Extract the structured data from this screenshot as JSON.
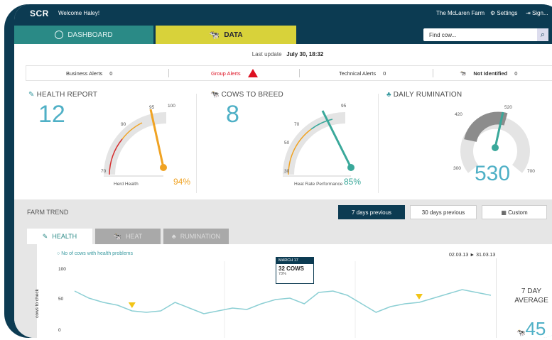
{
  "topbar": {
    "logo": "SCR",
    "welcome": "Welcome Haley!",
    "farm": "The McLaren Farm",
    "settings": "Settings",
    "signout": "Sign..."
  },
  "tabs": [
    {
      "label": "DASHBOARD",
      "icon": "gauge-icon"
    },
    {
      "label": "DATA",
      "icon": "cow-icon"
    }
  ],
  "search": {
    "placeholder": "Find cow..."
  },
  "last_update": {
    "label": "Last update",
    "value": "July 30, 18:32"
  },
  "alerts": [
    {
      "label": "Business Alerts",
      "count": "0"
    },
    {
      "label": "Group Alerts",
      "count": ""
    },
    {
      "label": "Technical Alerts",
      "count": "0"
    },
    {
      "label": "Not Identified",
      "count": "0"
    }
  ],
  "health": {
    "title": "HEALTH REPORT",
    "value": "12",
    "ticks": [
      "70",
      "90",
      "95",
      "100"
    ],
    "gauge_label": "Herd Health",
    "percent": "94%",
    "color": "#f0a323"
  },
  "breed": {
    "title": "COWS TO BREED",
    "value": "8",
    "ticks": [
      "30",
      "50",
      "70",
      "95"
    ],
    "gauge_label": "Heat Rate Performance",
    "percent": "85%",
    "color": "#3aa89a"
  },
  "rumination": {
    "title": "DAILY RUMINATION",
    "value": "530",
    "ticks": [
      "420",
      "520",
      "300",
      "700"
    ]
  },
  "farm_trend": {
    "title": "FARM TREND",
    "buttons": [
      "7 days previous",
      "30 days previous",
      "Custom"
    ],
    "subtabs": [
      "HEALTH",
      "HEAT",
      "RUMINATION"
    ],
    "legend": "No of cows with health problems",
    "date_range": "02.03.13 ► 31.03.13",
    "ylabel": "cows to check",
    "yticks": [
      "100",
      "50",
      "0"
    ],
    "tooltip": {
      "head": "MARCH 17",
      "main": "32 COWS",
      "sub": "73%"
    },
    "avg_label_1": "7 DAY",
    "avg_label_2": "AVERAGE",
    "avg_value": "45"
  },
  "chart_data": {
    "type": "line",
    "series": [
      {
        "values": [
          68,
          58,
          52,
          48,
          40,
          38,
          40,
          52,
          44,
          36,
          40,
          44,
          42,
          50,
          56,
          58,
          50,
          66,
          68,
          62,
          50,
          38,
          46,
          50,
          52,
          58,
          64,
          70,
          66,
          62
        ]
      }
    ],
    "ylim": [
      0,
      110
    ],
    "accent": "#8ccfd4",
    "markers": [
      {
        "index": 4,
        "color": "#f2c416"
      },
      {
        "index": 24,
        "color": "#f2c416"
      }
    ]
  }
}
